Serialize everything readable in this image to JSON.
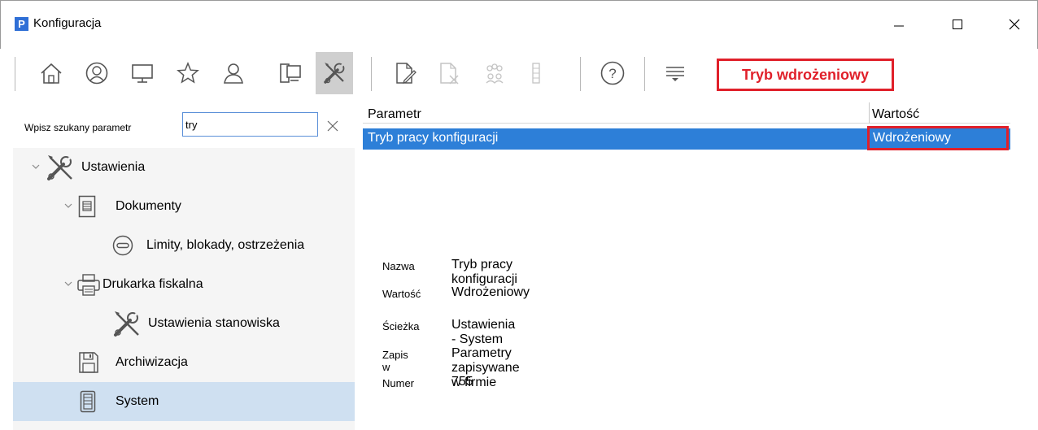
{
  "window": {
    "logo_letter": "P",
    "title": "Konfiguracja"
  },
  "toolbar": {
    "buttons": [
      "home-icon",
      "user-circle-icon",
      "computer-icon",
      "star-icon",
      "person-icon",
      "workstation-icon",
      "tools-icon",
      "edit-document-icon",
      "delete-document-icon",
      "group-icon",
      "list-icon",
      "help-icon",
      "filter-icon"
    ],
    "mode_badge": "Tryb wdrożeniowy"
  },
  "search": {
    "label": "Wpisz szukany parametr",
    "value": "try",
    "clear_icon": "close-icon"
  },
  "tree": [
    {
      "label": "Ustawienia",
      "icon": "tools-icon",
      "expanded": true
    },
    {
      "label": "Dokumenty",
      "icon": "document-icon",
      "expanded": true
    },
    {
      "label": "Limity, blokady, ostrzeżenia",
      "icon": "no-entry-icon"
    },
    {
      "label": "Drukarka fiskalna",
      "icon": "printer-icon",
      "expanded": true
    },
    {
      "label": "Ustawienia stanowiska",
      "icon": "tools-icon"
    },
    {
      "label": "Archiwizacja",
      "icon": "floppy-icon"
    },
    {
      "label": "System",
      "icon": "server-icon",
      "selected": true
    }
  ],
  "grid": {
    "headers": [
      "Parametr",
      "Wartość"
    ],
    "rows": [
      {
        "param": "Tryb pracy konfiguracji",
        "value": "Wdrożeniowy"
      }
    ]
  },
  "details": {
    "labels": [
      "Nazwa",
      "Wartość",
      "Ścieżka",
      "Zapis w",
      "Numer"
    ],
    "values": [
      "Tryb pracy konfiguracji",
      "Wdrożeniowy",
      "Ustawienia - System",
      "Parametry zapisywane w firmie",
      "755"
    ]
  },
  "colors": {
    "accent_red": "#e0202a",
    "selection_blue": "#2d7fd8",
    "tree_selected": "#cfe0f1"
  }
}
